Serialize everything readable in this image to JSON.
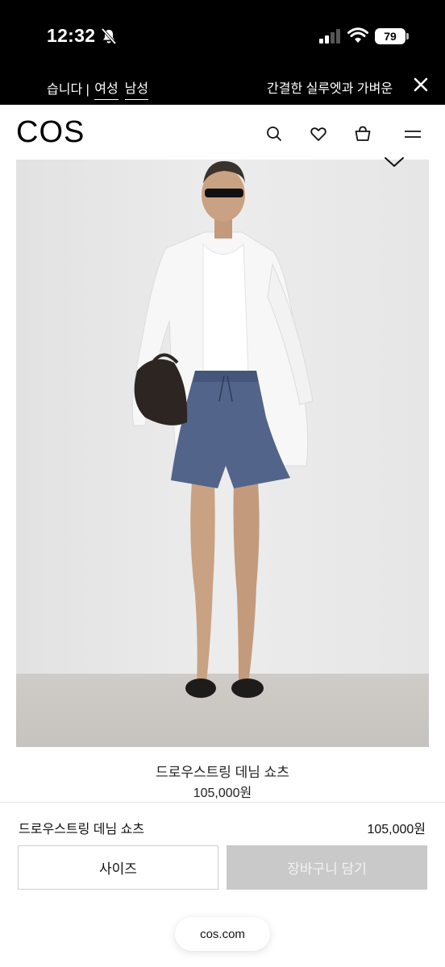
{
  "status_bar": {
    "time": "12:32",
    "battery": "79",
    "icons": [
      "bell-slash-icon",
      "signal-icon",
      "wifi-icon",
      "battery-icon"
    ]
  },
  "banner": {
    "left_prefix": "습니다 | ",
    "link_women": "여성",
    "link_men": "남성",
    "right_text": "간결한 실루엣과 가벼운",
    "close_icon": "close-icon"
  },
  "header": {
    "logo": "COS",
    "icons": [
      "search-icon",
      "heart-icon",
      "bag-icon",
      "menu-icon"
    ]
  },
  "product": {
    "title": "드로우스트링 데님 쇼츠",
    "price": "105,000원",
    "image_icon": "chevron-down-icon"
  },
  "purchase_bar": {
    "name": "드로우스트링 데님 쇼츠",
    "price": "105,000원",
    "size_label": "사이즈",
    "cart_label": "장바구니 담기"
  },
  "browser": {
    "url": "cos.com"
  },
  "colors": {
    "background": "#ffffff",
    "banner": "#000000",
    "cart_disabled": "#c9c9c9"
  }
}
